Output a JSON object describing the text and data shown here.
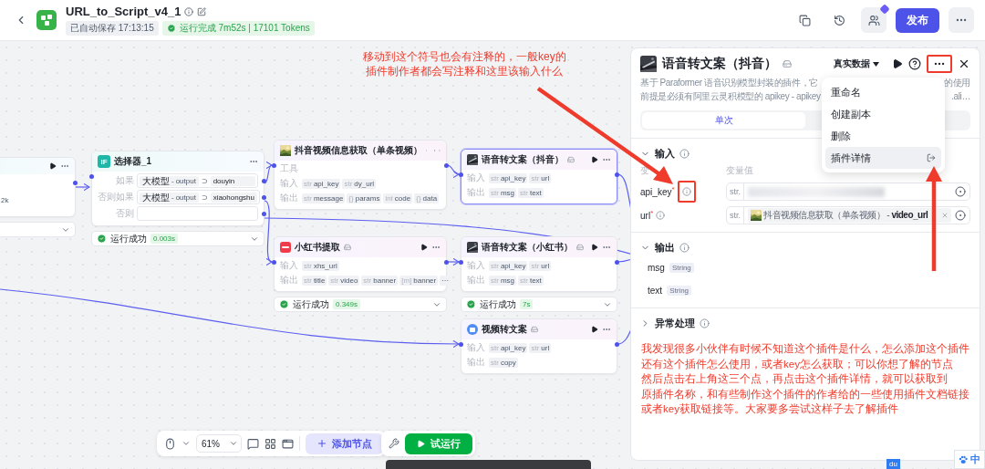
{
  "header": {
    "title": "URL_to_Script_v4_1",
    "autosave": "已自动保存 17:13:15",
    "run_status": "运行完成 7m52s | 17101 Tokens",
    "publish": "发布"
  },
  "top_note": [
    "移动到这个符号也会有注释的，一般key的",
    "插件制作者都会写注释和这里该输入什么"
  ],
  "canvas": {
    "nodes": [
      {
        "kind": "partial",
        "text": "2k"
      },
      {
        "kind": "condition",
        "badge": "IF",
        "title": "选择器_1",
        "branches": [
          {
            "label": "如果",
            "source": "大模型",
            "separator": "-",
            "variable": "output",
            "operator": "⊃",
            "value": "douyin"
          },
          {
            "label": "否则如果",
            "source": "大模型",
            "separator": "-",
            "variable": "output",
            "operator": "⊃",
            "value": "xiaohongshu"
          },
          {
            "label": "否则"
          }
        ],
        "status": {
          "label": "运行成功",
          "time": "0.003s"
        }
      },
      {
        "kind": "plugin",
        "title": "抖音视频信息获取（单条视频）",
        "selected": false,
        "group_label": "工具",
        "input_label": "输入",
        "inputs": [
          {
            "type": "str",
            "name": "api_key"
          },
          {
            "type": "str",
            "name": "dy_url"
          }
        ],
        "output_label": "输出",
        "outputs": [
          {
            "type": "str",
            "name": "message"
          },
          {
            "type": "{}",
            "name": "params"
          },
          {
            "type": "int",
            "name": "code"
          },
          {
            "type": "{}",
            "name": "data"
          }
        ]
      },
      {
        "kind": "plugin",
        "title": "语音转文案（抖音）",
        "selected": true,
        "input_label": "输入",
        "inputs": [
          {
            "type": "str",
            "name": "api_key"
          },
          {
            "type": "str",
            "name": "url"
          }
        ],
        "output_label": "输出",
        "outputs": [
          {
            "type": "str",
            "name": "msg"
          },
          {
            "type": "str",
            "name": "text"
          }
        ]
      },
      {
        "kind": "plugin",
        "title": "小红书提取",
        "selected": false,
        "input_label": "输入",
        "inputs": [
          {
            "type": "str",
            "name": "xhs_url"
          }
        ],
        "output_label": "输出",
        "outputs": [
          {
            "type": "str",
            "name": "title"
          },
          {
            "type": "str",
            "name": "video"
          },
          {
            "type": "str",
            "name": "banner"
          },
          {
            "type": "[m]",
            "name": "banner"
          }
        ],
        "overflow": "···",
        "status": {
          "label": "运行成功",
          "time": "0.349s"
        }
      },
      {
        "kind": "plugin",
        "title": "语音转文案（小红书）",
        "selected": false,
        "input_label": "输入",
        "inputs": [
          {
            "type": "str",
            "name": "api_key"
          },
          {
            "type": "str",
            "name": "url"
          }
        ],
        "output_label": "输出",
        "outputs": [
          {
            "type": "str",
            "name": "msg"
          },
          {
            "type": "str",
            "name": "text"
          }
        ],
        "status": {
          "label": "运行成功",
          "time": "7s"
        }
      },
      {
        "kind": "plugin",
        "title": "视频转文案",
        "selected": false,
        "input_label": "输入",
        "inputs": [
          {
            "type": "str",
            "name": "api_key"
          },
          {
            "type": "str",
            "name": "url"
          }
        ],
        "output_label": "输出",
        "outputs": [
          {
            "type": "str",
            "name": "copy"
          }
        ]
      }
    ]
  },
  "panel": {
    "title": "语音转文案（抖音）",
    "data_mode": "真实数据",
    "more_highlighted": true,
    "description": [
      {
        "left": "基于 Paraformer 语音识别模型封装的插件，它",
        "right": "的使用"
      },
      {
        "left": "前提是必须有阿里云灵积模型的 apikey - apikey",
        "right": ".ali…"
      }
    ],
    "tabs": [
      {
        "label": "单次",
        "selected": true
      }
    ],
    "input_section": {
      "title": "输入",
      "expanded": true,
      "name_header": "变",
      "value_header": "变量值",
      "rows": [
        {
          "name": "api_key",
          "mark": "*",
          "highlighted": true,
          "type": "str.",
          "kind": "masked"
        },
        {
          "name": "url",
          "mark": "*",
          "highlighted": false,
          "type": "str.",
          "kind": "reference",
          "value": "抖音视频信息获取（单条视频） - **video_url**"
        }
      ]
    },
    "output_section": {
      "title": "输出",
      "expanded": true,
      "rows": [
        {
          "name": "msg",
          "type": "String"
        },
        {
          "name": "text",
          "type": "String"
        }
      ]
    },
    "error_section": {
      "title": "异常处理",
      "expanded": false
    },
    "note": [
      "我发现很多小伙伴有时候不知道这个插件是什么，怎么添加这个插件",
      "还有这个插件怎么使用，或者key怎么获取；可以你想了解的节点",
      "然后点击右上角这三个点，再点击这个插件详情，就可以获取到",
      "原插件名称，和有些制作这个插件的作者给的一些使用插件文档链接",
      "或者key获取链接等。大家要多尝试这样子去了解插件"
    ]
  },
  "menu": {
    "items": [
      {
        "label": "重命名",
        "selected": false,
        "kind": "action"
      },
      {
        "label": "创建副本",
        "selected": false,
        "kind": "action"
      },
      {
        "label": "删除",
        "selected": false,
        "kind": "action"
      },
      {
        "label": "插件详情",
        "selected": true,
        "kind": "link"
      }
    ]
  },
  "toolbar": {
    "zoom": "61%",
    "add_node": "添加节点",
    "test_run": "试运行"
  },
  "tray": {
    "app": "du",
    "ime": "中"
  }
}
